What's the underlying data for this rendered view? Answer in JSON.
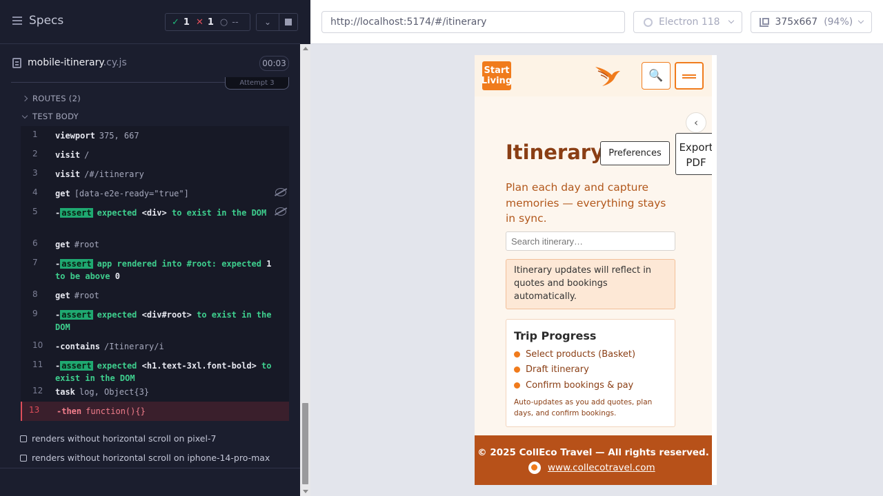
{
  "left": {
    "specs_label": "Specs",
    "stats": {
      "passed": "1",
      "failed": "1",
      "pending": "--"
    },
    "spec_file": {
      "name": "mobile-itinerary",
      "ext": ".cy.js",
      "duration": "00:03"
    },
    "attempt_label": "Attempt 3",
    "routes_label": "ROUTES (2)",
    "test_body_label": "TEST BODY",
    "commands": [
      {
        "num": "1",
        "name": "viewport",
        "msg": "375, 667"
      },
      {
        "num": "2",
        "name": "visit",
        "msg": "/"
      },
      {
        "num": "3",
        "name": "visit",
        "msg": "/#/itinerary"
      },
      {
        "num": "4",
        "name": "get",
        "msg": "[data-e2e-ready=\"true\"]"
      },
      {
        "num": "5",
        "assert_badge": "assert",
        "text_a": "expected",
        "text_b": "<div>",
        "text_c": "to exist in the DOM"
      },
      {
        "num": "6",
        "name": "get",
        "msg": "#root"
      },
      {
        "num": "7",
        "assert_badge": "assert",
        "text_a": "app rendered into #root: expected",
        "text_b": "1",
        "text_c": "to be above",
        "text_d": "0"
      },
      {
        "num": "8",
        "name": "get",
        "msg": "#root"
      },
      {
        "num": "9",
        "assert_badge": "assert",
        "text_a": "expected",
        "text_b": "<div#root>",
        "text_c": "to exist in the DOM"
      },
      {
        "num": "10",
        "name": "-contains",
        "msg": "/Itinerary/i"
      },
      {
        "num": "11",
        "assert_badge": "assert",
        "text_a": "expected",
        "text_b": "<h1.text-3xl.font-bold>",
        "text_c": "to exist in the DOM"
      },
      {
        "num": "12",
        "name": "task",
        "msg": "log, Object{3}"
      },
      {
        "num": "13",
        "name": "-then",
        "msg": "function(){}"
      }
    ],
    "tests": [
      "renders without horizontal scroll on pixel-7",
      "renders without horizontal scroll on iphone-14-pro-max"
    ]
  },
  "browser_bar": {
    "url": "http://localhost:5174/#/itinerary",
    "browser": "Electron 118",
    "viewport": "375x667",
    "scale": "(94%)"
  },
  "app": {
    "logo_text": "Start Living",
    "collapse_glyph": "‹",
    "title": "Itinerary",
    "preferences_label": "Preferences",
    "export_label": "Export PDF",
    "subtitle": "Plan each day and capture memories — everything stays in sync.",
    "search_placeholder": "Search itinerary…",
    "notice": "Itinerary updates will reflect in quotes and bookings automatically.",
    "progress": {
      "title": "Trip Progress",
      "steps": [
        "Select products (Basket)",
        "Draft itinerary",
        "Confirm bookings & pay"
      ],
      "note": "Auto-updates as you add quotes, plan days, and confirm bookings."
    },
    "footer": {
      "copyright": "© 2025 CollEco Travel — All rights reserved.",
      "link": "www.collecotravel.com"
    },
    "colors": {
      "brand_orange": "#f07b1c",
      "footer_bg": "#b75119",
      "title_brown": "#8a3e14"
    }
  }
}
